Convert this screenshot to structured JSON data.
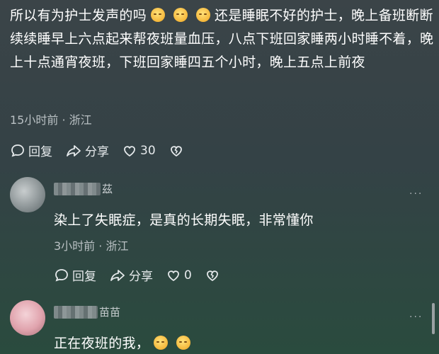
{
  "main_comment": {
    "text_part1": "所以有为护士发声的吗",
    "text_part2": "还是睡眠不好的护士，晚上备班断断续续睡早上六点起来帮夜班量血压，八点下班回家睡两小时睡不着，晚上十点通宵夜班，下班回家睡四五个小时，晚上五点上前夜",
    "meta": "15小时前 · 浙江",
    "reply_label": "回复",
    "share_label": "分享",
    "like_count": "30"
  },
  "reply1": {
    "name_tail": "茲",
    "text": "染上了失眠症，是真的长期失眠，非常懂你",
    "meta": "3小时前 · 浙江",
    "reply_label": "回复",
    "share_label": "分享",
    "like_count": "0",
    "more_label": "···"
  },
  "reply2": {
    "name_tail": "苗苗",
    "text": "正在夜班的我，",
    "more_label": "···"
  },
  "colors": {
    "background_top": "#3b4448",
    "background_bottom": "#2a4b3e",
    "meta_text": "#b9c0c3"
  }
}
